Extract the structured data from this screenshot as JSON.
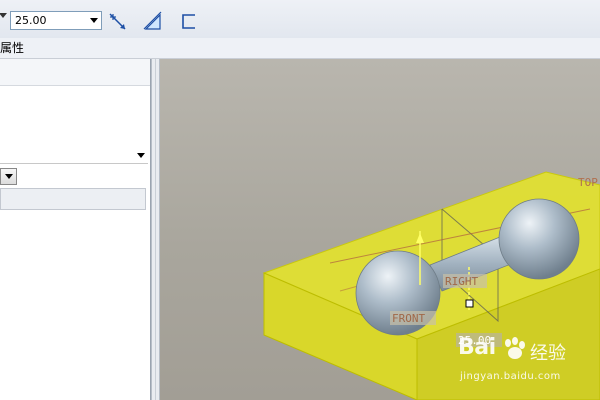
{
  "toolbar": {
    "depth_value": "25.00",
    "icons": [
      "flip-direction-icon",
      "thicken-icon",
      "to-selected-icon"
    ]
  },
  "menubar": {
    "properties_label": "属性"
  },
  "viewport": {
    "datum_labels": {
      "top": "TOP",
      "right": "RIGHT",
      "front": "FRONT"
    },
    "dimension_label": "25.00",
    "colors": {
      "extrude_preview": "#e6e635",
      "model": "#a9b8c6",
      "background": "#aeaba3"
    }
  },
  "watermark": {
    "brand": "Bai",
    "brand_suffix": "经验",
    "url": "jingyan.baidu.com"
  }
}
